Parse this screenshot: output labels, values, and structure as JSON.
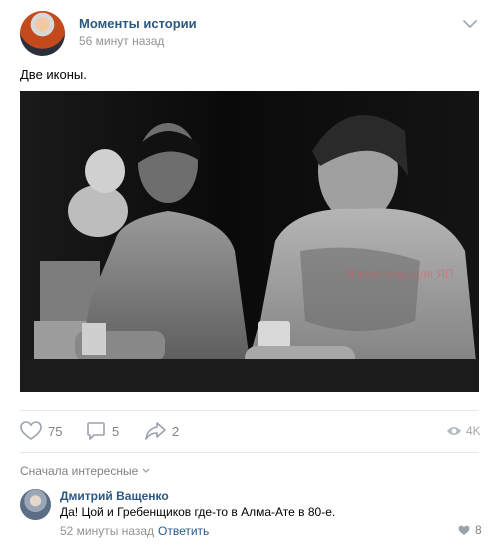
{
  "post": {
    "author": "Моменты истории",
    "time": "56 минут назад",
    "text": "Две иконы.",
    "watermark": "Я кекотанш для ЯП"
  },
  "actions": {
    "likes": "75",
    "comments": "5",
    "shares": "2",
    "views": "4K"
  },
  "comments": {
    "sort_label": "Сначала интересные",
    "items": [
      {
        "author": "Дмитрий Ващенко",
        "text": "Да! Цой и Гребенщиков где-то в Алма-Ате в 80-е.",
        "time": "52 минуты назад",
        "reply_label": "Ответить",
        "likes": "8"
      }
    ]
  },
  "icons": {
    "menu": "chevron-down-icon",
    "like": "heart-icon",
    "comment": "comment-icon",
    "share": "share-arrow-icon",
    "views": "eye-icon"
  },
  "colors": {
    "link": "#2a5885",
    "muted": "#828282",
    "divider": "#e7e8ec"
  }
}
